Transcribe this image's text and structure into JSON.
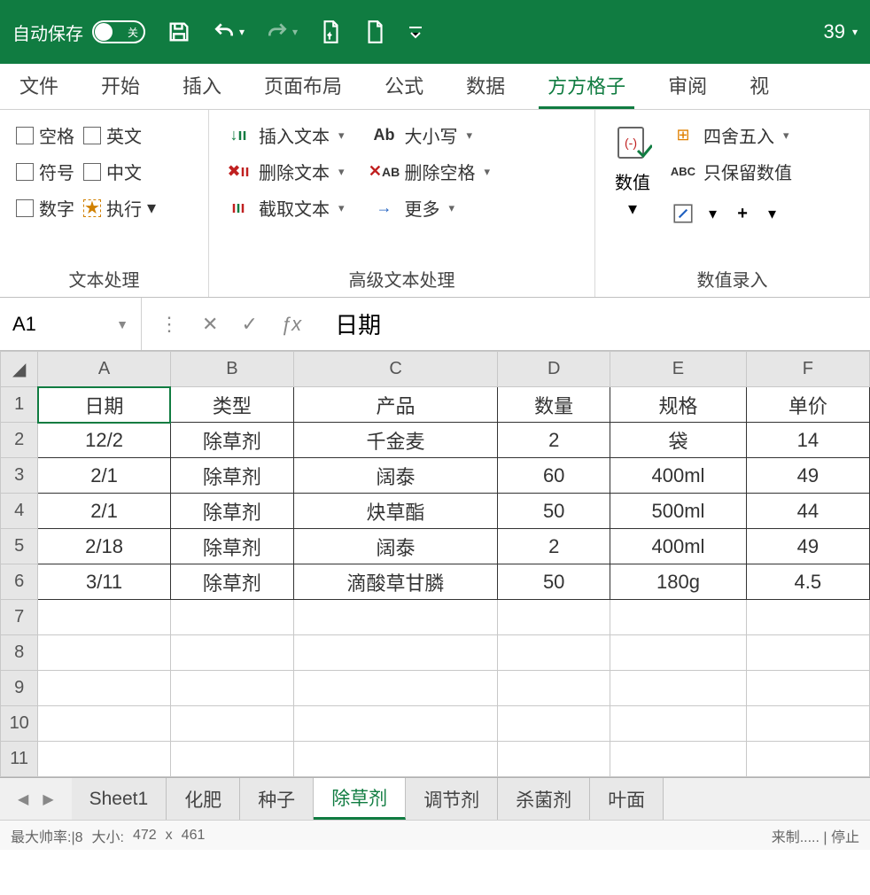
{
  "titlebar": {
    "autosave_label": "自动保存",
    "autosave_toggle_text": "关",
    "zoom_value": "39"
  },
  "ribbon_tabs": [
    "文件",
    "开始",
    "插入",
    "页面布局",
    "公式",
    "数据",
    "方方格子",
    "审阅",
    "视"
  ],
  "active_ribbon_tab": 6,
  "ribbon": {
    "group1": {
      "label": "文本处理",
      "cb": [
        "空格",
        "英文",
        "符号",
        "中文",
        "数字",
        "执行"
      ]
    },
    "group2": {
      "label": "高级文本处理",
      "colA": [
        "插入文本",
        "删除文本",
        "截取文本"
      ],
      "colB": [
        "大小写",
        "删除空格",
        "更多"
      ]
    },
    "group3": {
      "label": "数值录入",
      "bigbtn": "数值",
      "rows": [
        "四舍五入",
        "只保留数值"
      ]
    }
  },
  "namebox": "A1",
  "formula": "日期",
  "columns": [
    "A",
    "B",
    "C",
    "D",
    "E",
    "F"
  ],
  "headers": [
    "日期",
    "类型",
    "产品",
    "数量",
    "规格",
    "单价"
  ],
  "rows": [
    [
      "12/2",
      "除草剂",
      "千金麦",
      "2",
      "袋",
      "14"
    ],
    [
      "2/1",
      "除草剂",
      "阔泰",
      "60",
      "400ml",
      "49"
    ],
    [
      "2/1",
      "除草剂",
      "炔草酯",
      "50",
      "500ml",
      "44"
    ],
    [
      "2/18",
      "除草剂",
      "阔泰",
      "2",
      "400ml",
      "49"
    ],
    [
      "3/11",
      "除草剂",
      "滴酸草甘膦",
      "50",
      "180g",
      "4.5"
    ]
  ],
  "empty_rows": 5,
  "sheets": [
    "Sheet1",
    "化肥",
    "种子",
    "除草剂",
    "调节剂",
    "杀菌剂",
    "叶面"
  ],
  "active_sheet": 3,
  "status": {
    "left": "最大帅率:|8",
    "size_label": "大小:",
    "w": "472",
    "x": "x",
    "h": "461",
    "right": "来制.....   | 停止"
  }
}
